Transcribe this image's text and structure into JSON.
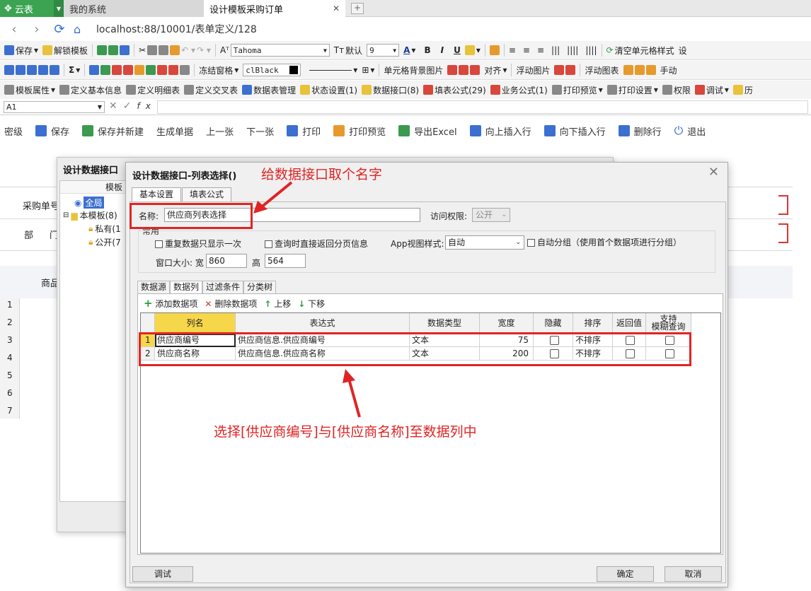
{
  "browser": {
    "brand": "云表",
    "tabs": [
      {
        "label": "我的系统"
      },
      {
        "label": "设计模板采购订单"
      }
    ],
    "url": "localhost:88/10001/表单定义/128"
  },
  "toolbar1": {
    "items": [
      "保存",
      "解锁模板",
      "清空单元格样式",
      "设"
    ],
    "font_name": "Tahoma",
    "default_label": "默认",
    "font_size": "9",
    "bold": "B",
    "italic": "I",
    "underline": "U"
  },
  "toolbar2": {
    "freeze": "冻结窗格",
    "color_value": "clBlack",
    "cell_bg_image": "单元格背景图片",
    "align": "对齐",
    "float_image": "浮动图片",
    "float_chart": "浮动图表",
    "manual": "手动"
  },
  "toolbar3": {
    "items": [
      "模板属性",
      "定义基本信息",
      "定义明细表",
      "定义交叉表",
      "数据表管理",
      "状态设置(1)",
      "数据接口(8)",
      "填表公式(29)",
      "业务公式(1)",
      "打印预览",
      "打印设置",
      "权限",
      "调试",
      "历"
    ]
  },
  "formula_bar": {
    "cell_ref": "A1",
    "fx": "fx"
  },
  "actions": [
    "密级",
    "保存",
    "保存并新建",
    "生成单据",
    "上一张",
    "下一张",
    "打印",
    "打印预览",
    "导出Excel",
    "向上插入行",
    "向下插入行",
    "删除行",
    "退出"
  ],
  "background": {
    "labels": [
      "采购单号",
      "部",
      "门",
      "商品"
    ],
    "row_numbers": [
      "1",
      "2",
      "3",
      "4",
      "5",
      "6",
      "7"
    ]
  },
  "outer_dialog": {
    "title": "设计数据接口",
    "tree_header": "模板",
    "tree": [
      {
        "label": "全局"
      },
      {
        "label": "本模板(8)"
      },
      {
        "label": "私有(1"
      },
      {
        "label": "公开(7"
      }
    ]
  },
  "dialog": {
    "title": "设计数据接口-列表选择()",
    "tabs": [
      "基本设置",
      "填表公式"
    ],
    "name_label": "名称:",
    "name_value": "供应商列表选择",
    "access_label": "访问权限:",
    "access_value": "公开",
    "group_label": "常用",
    "opt_repeat": "重复数据只显示一次",
    "opt_paging": "查询时直接返回分页信息",
    "app_view_label": "App视图样式:",
    "app_view_value": "自动",
    "auto_group": "自动分组（使用首个数据项进行分组）",
    "win_size_label": "窗口大小: 宽",
    "width_value": "860",
    "height_label": "高",
    "height_value": "564",
    "subtabs": [
      "数据源",
      "数据列",
      "过滤条件",
      "分类树"
    ],
    "grid_toolbar": {
      "add": "添加数据项",
      "delete": "删除数据项",
      "up": "上移",
      "down": "下移"
    },
    "columns": [
      "列名",
      "表达式",
      "数据类型",
      "宽度",
      "隐藏",
      "排序",
      "返回值",
      "支持\n模糊查询"
    ],
    "rows": [
      {
        "idx": "1",
        "name": "供应商编号",
        "expr": "供应商信息.供应商编号",
        "type": "文本",
        "width": "75",
        "sort": "不排序",
        "hidden": false,
        "ret": false,
        "fuzzy": false
      },
      {
        "idx": "2",
        "name": "供应商名称",
        "expr": "供应商信息.供应商名称",
        "type": "文本",
        "width": "200",
        "sort": "不排序",
        "hidden": false,
        "ret": false,
        "fuzzy": false
      }
    ],
    "buttons": {
      "debug": "调试",
      "ok": "确定",
      "cancel": "取消"
    }
  },
  "annotations": {
    "name_hint": "给数据接口取个名字",
    "columns_hint": "选择[供应商编号]与[供应商名称]至数据列中"
  },
  "colors": {
    "accent_green": "#3ba351",
    "annotation_red": "#e02424",
    "header_yellow": "#f7d74a"
  }
}
